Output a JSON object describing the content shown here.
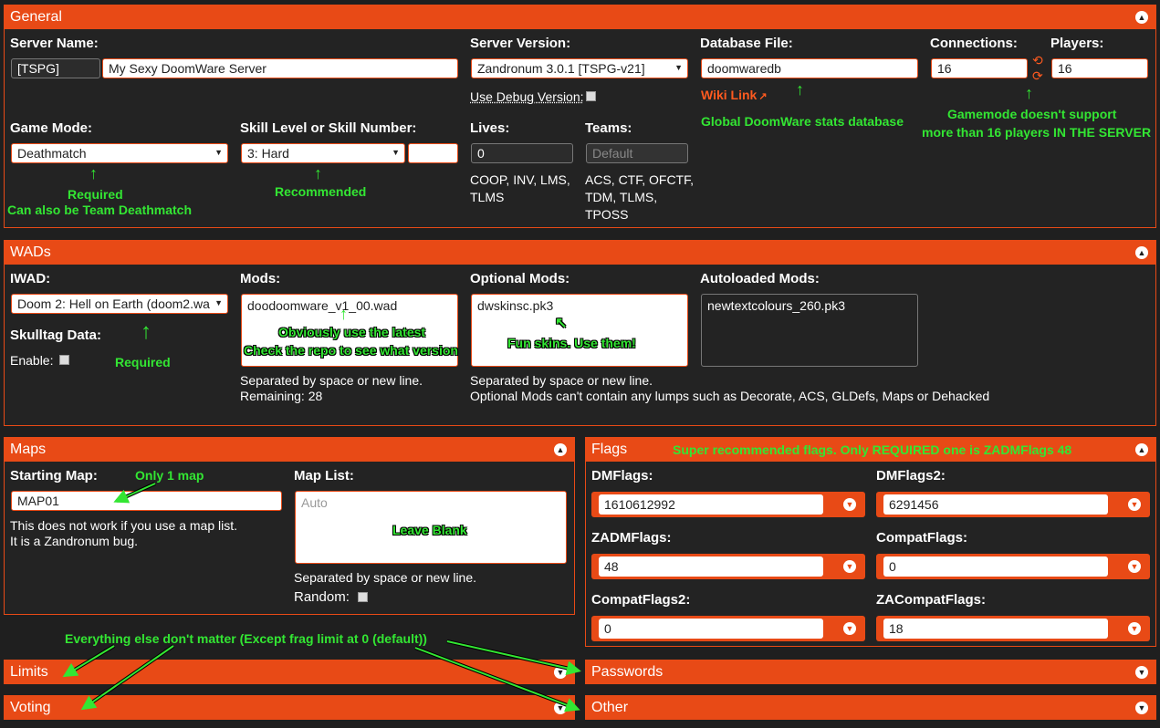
{
  "general": {
    "title": "General",
    "server_name_label": "Server Name:",
    "server_tag": "[TSPG]",
    "server_name": "My Sexy DoomWare Server",
    "server_version_label": "Server Version:",
    "server_version": "Zandronum 3.0.1 [TSPG-v21]",
    "debug_label": "Use Debug Version:",
    "database_label": "Database File:",
    "database_value": "doomwaredb",
    "wiki_link": "Wiki Link",
    "connections_label": "Connections:",
    "connections_value": "16",
    "players_label": "Players:",
    "players_value": "16",
    "game_mode_label": "Game Mode:",
    "game_mode": "Deathmatch",
    "skill_label": "Skill Level or Skill Number:",
    "skill_value": "3: Hard",
    "lives_label": "Lives:",
    "lives_value": "0",
    "lives_note_1": "COOP, INV, LMS,",
    "lives_note_2": "TLMS",
    "teams_label": "Teams:",
    "teams_placeholder": "Default",
    "teams_note_1": "ACS, CTF, OFCTF,",
    "teams_note_2": "TDM, TLMS,",
    "teams_note_3": "TPOSS"
  },
  "wads": {
    "title": "WADs",
    "iwad_label": "IWAD:",
    "iwad_value": "Doom 2: Hell on Earth (doom2.wa",
    "skulltag_label": "Skulltag Data:",
    "enable_label": "Enable:",
    "mods_label": "Mods:",
    "mods_value": "doomware_v1_00.wad",
    "mods_prefix": "doo",
    "mods_note_1": "Separated by space or new line.",
    "mods_note_2": "Remaining: 28",
    "optional_label": "Optional Mods:",
    "optional_value": "dwskinsc.pk3",
    "optional_note_1": "Separated by space or new line.",
    "optional_note_2": "Optional Mods can't contain any lumps such as Decorate, ACS, GLDefs, Maps or Dehacked",
    "autoloaded_label": "Autoloaded Mods:",
    "autoloaded_value": "newtextcolours_260.pk3"
  },
  "maps": {
    "title": "Maps",
    "starting_label": "Starting Map:",
    "starting_value": "MAP01",
    "starting_note_1": "This does not work if you use a map list.",
    "starting_note_2": "It is a Zandronum bug.",
    "maplist_label": "Map List:",
    "maplist_placeholder": "Auto",
    "maplist_note": "Separated by space or new line.",
    "random_label": "Random:"
  },
  "flags": {
    "title": "Flags",
    "items": [
      {
        "label": "DMFlags:",
        "value": "1610612992"
      },
      {
        "label": "DMFlags2:",
        "value": "6291456"
      },
      {
        "label": "ZADMFlags:",
        "value": "48"
      },
      {
        "label": "CompatFlags:",
        "value": "0"
      },
      {
        "label": "CompatFlags2:",
        "value": "0"
      },
      {
        "label": "ZACompatFlags:",
        "value": "18"
      }
    ]
  },
  "collapsed": {
    "limits": "Limits",
    "voting": "Voting",
    "passwords": "Passwords",
    "other": "Other"
  },
  "annotations": {
    "stats_db": "Global DoomWare stats database",
    "gamemode_1": "Gamemode doesn't support",
    "gamemode_2": "more than 16 players IN THE SERVER",
    "required_1": "Required",
    "team_dm": "Can also be Team Deathmatch",
    "recommended": "Recommended",
    "latest": "Obviously use the latest",
    "repo": "Check the repo to see what version",
    "required_2": "Required",
    "skins": "Fun skins. Use them!",
    "one_map": "Only 1 map",
    "blank": "Leave Blank",
    "flags_note": "Super recommended flags. Only REQUIRED one is ZADMFlags 48",
    "else": "Everything else don't matter (Except frag limit at 0 (default))"
  },
  "colors": {
    "accent": "#e84a16",
    "annotation": "#33e633",
    "background": "#1f1f1f"
  }
}
